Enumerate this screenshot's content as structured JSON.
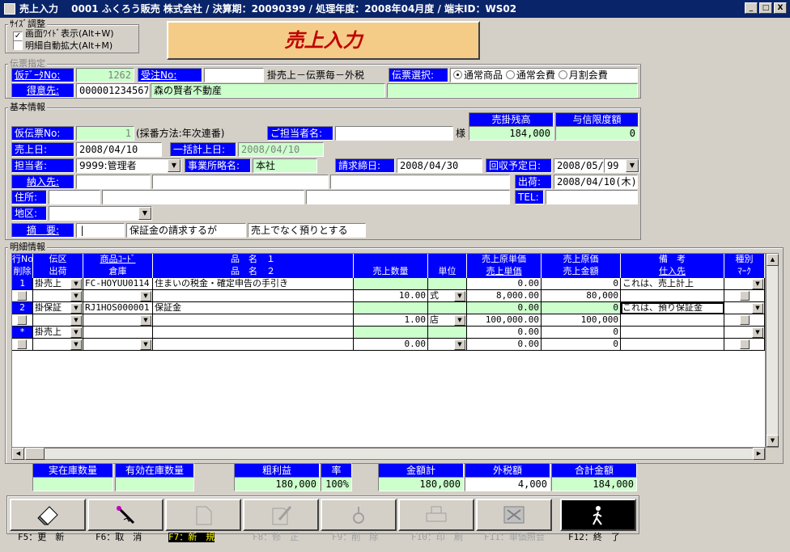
{
  "window": {
    "title": "売上入力　 0001 ふくろう販売 株式会社 / 決算期：20090399 / 処理年度：2008年04月度 / 端末ID：WS02",
    "min": "_",
    "max": "□",
    "close": "X"
  },
  "size_group": {
    "title": "ｻｲｽﾞ調整",
    "wide": "画面ﾜｲﾄﾞ表示(Alt+W)",
    "zoom": "明細自動拡大(Alt+M)"
  },
  "banner": "売上入力",
  "slip": {
    "title": "伝票指定",
    "kari_data_label": "仮ﾃﾞｰﾀNo:",
    "kari_data_value": "1262",
    "juchu_label": "受注No:",
    "juchu_value": "",
    "sales_type_text": "掛売上－伝票毎－外税",
    "select_label": "伝票選択:",
    "opt1": "通常商品",
    "opt2": "通常会費",
    "opt3": "月割会費",
    "customer_label": "得意先:",
    "customer_code": "000001234567",
    "customer_name": "森の賢者不動産"
  },
  "basic": {
    "title": "基本情報",
    "kari_slip_label": "仮伝票No:",
    "kari_slip_value": "1",
    "numbering_note": "(採番方法:年次連番)",
    "tanto_label": "ご担当者名:",
    "tanto_value": "",
    "sama": "様",
    "balance_label": "売掛残高",
    "balance_value": "184,000",
    "credit_label": "与信限度額",
    "credit_value": "0",
    "sales_date_label": "売上日:",
    "sales_date_value": "2008/04/10",
    "ikkatsu_label": "一括計上日:",
    "ikkatsu_value": "2008/04/10",
    "staff_label": "担当者:",
    "staff_value": "9999:管理者",
    "office_label": "事業所略名:",
    "office_value": "本社",
    "billing_label": "請求締日:",
    "billing_value": "2008/04/30",
    "collect_label": "回収予定日:",
    "collect_value": "2008/05/",
    "collect_day": "99",
    "delivery_label": "納入先:",
    "ship_label": "出荷:",
    "ship_value": "2008/04/10(木)",
    "address_label": "住所:",
    "tel_label": "TEL:",
    "area_label": "地区:",
    "memo_label": "摘　要:",
    "memo1": "保証金の請求するが",
    "memo2": "売上でなく預りとする"
  },
  "detail": {
    "title": "明細情報",
    "headers1": [
      "行No",
      "伝区",
      "商品ｺｰﾄﾞ",
      "品　名　１",
      "",
      "",
      "売上原単価",
      "売上原価",
      "備　考",
      "種別"
    ],
    "headers2": [
      "削除",
      "出荷",
      "倉庫",
      "品　名　２",
      "売上数量",
      "単位",
      "売上単価",
      "売上金額",
      "仕入先",
      "ﾏｰｸ"
    ],
    "rows": [
      {
        "no": "1",
        "kubun": "掛売上",
        "code": "FC-HOYUU0114",
        "name1": "住まいの税金・確定申告の手引き",
        "cost_unit": "0.00",
        "cost": "0",
        "memo": "これは、売上計上",
        "qty": "10.00",
        "unit": "式",
        "price": "8,000.00",
        "amount": "80,000"
      },
      {
        "no": "2",
        "kubun": "掛保証",
        "code": "RJ1HOS000001",
        "name1": "保証金",
        "cost_unit": "0.00",
        "cost": "0",
        "memo": "これは、預り保証金",
        "qty": "1.00",
        "unit": "店",
        "price": "100,000.00",
        "amount": "100,000"
      },
      {
        "no": "*",
        "kubun": "掛売上",
        "code": "",
        "name1": "",
        "cost_unit": "0.00",
        "cost": "0",
        "memo": "",
        "qty": "0.00",
        "unit": "",
        "price": "0.00",
        "amount": "0"
      }
    ]
  },
  "totals": {
    "stock_label": "実在庫数量",
    "avail_label": "有効在庫数量",
    "profit_label": "粗利益",
    "rate_label": "率",
    "profit_value": "180,000",
    "rate_value": "100%",
    "sum_label": "金額計",
    "tax_label": "外税額",
    "total_label": "合計金額",
    "sum_value": "180,000",
    "tax_value": "4,000",
    "total_value": "184,000"
  },
  "fkeys": [
    "F5：更　新",
    "F6：取　消",
    "F7：新　規",
    "F8：修　正",
    "F9：削　除",
    "F10：印　刷",
    "F11：単価照会",
    "F12：終　了"
  ]
}
